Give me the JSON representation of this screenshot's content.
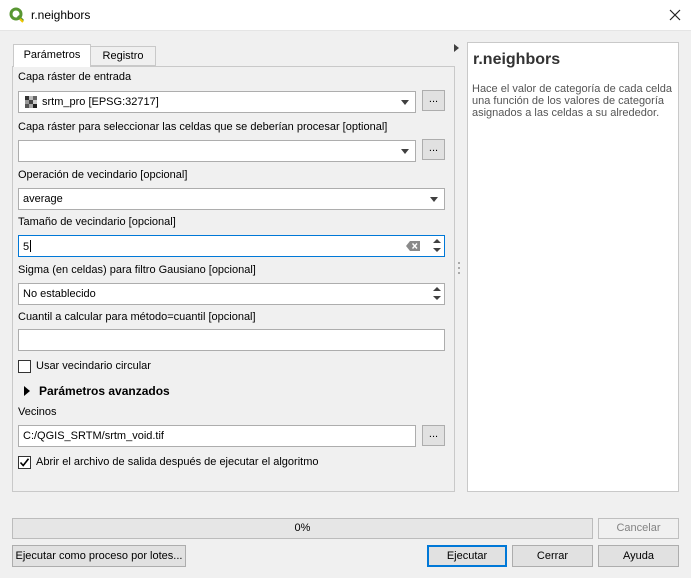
{
  "window": {
    "title": "r.neighbors"
  },
  "tabs": [
    {
      "label": "Parámetros"
    },
    {
      "label": "Registro"
    }
  ],
  "params": {
    "input_label": "Capa ráster de entrada",
    "input_value": "srtm_pro [EPSG:32717]",
    "selection_label": "Capa ráster para seleccionar las celdas que se deberían procesar [optional]",
    "selection_value": "",
    "operation_label": "Operación de vecindario [opcional]",
    "operation_value": "average",
    "size_label": "Tamaño de vecindario [opcional]",
    "size_value": "5",
    "sigma_label": "Sigma (en celdas) para filtro Gausiano [opcional]",
    "sigma_value": "No establecido",
    "quantile_label": "Cuantil a calcular para método=cuantil [opcional]",
    "quantile_value": "",
    "circular_label": "Usar vecindario circular",
    "circular_checked": false,
    "advanced_label": "Parámetros avanzados",
    "output_label": "Vecinos",
    "output_value": "C:/QGIS_SRTM/srtm_void.tif",
    "open_output_label": "Abrir el archivo de salida después de ejecutar el algoritmo",
    "open_output_checked": true,
    "browse_label": "..."
  },
  "help": {
    "title": "r.neighbors",
    "text": "Hace el valor de categoría de cada celda una función de los valores de categoría asignados a las celdas a su alrededor."
  },
  "progress": {
    "label": "0%",
    "value": 0
  },
  "buttons": {
    "cancel": "Cancelar",
    "batch": "Ejecutar como proceso por lotes...",
    "run": "Ejecutar",
    "close": "Cerrar",
    "help": "Ayuda"
  },
  "colors": {
    "accent": "#0078d7",
    "qgis_green": "#589632",
    "qgis_yellow": "#f0c600"
  },
  "icons": {
    "app": "qgis-logo-icon",
    "close": "close-icon",
    "raster": "raster-layer-icon",
    "clear": "clear-text-icon",
    "expand": "chevron-right-icon"
  }
}
